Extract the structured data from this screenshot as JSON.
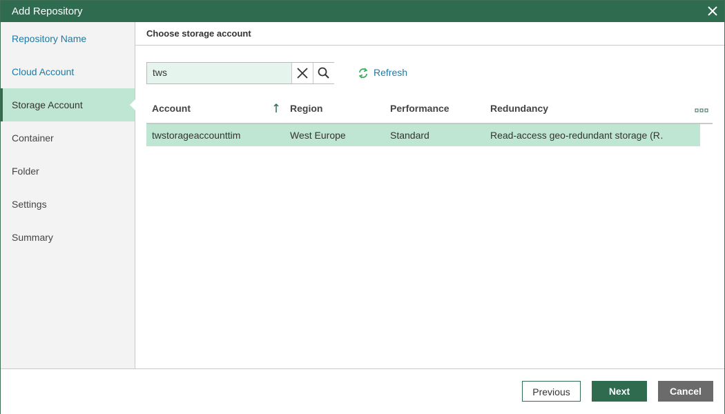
{
  "window": {
    "title": "Add Repository"
  },
  "sidebar": {
    "items": [
      {
        "label": "Repository Name",
        "state": "done"
      },
      {
        "label": "Cloud Account",
        "state": "done"
      },
      {
        "label": "Storage Account",
        "state": "active"
      },
      {
        "label": "Container",
        "state": "pending"
      },
      {
        "label": "Folder",
        "state": "pending"
      },
      {
        "label": "Settings",
        "state": "pending"
      },
      {
        "label": "Summary",
        "state": "pending"
      }
    ]
  },
  "main": {
    "section_title": "Choose storage account",
    "search": {
      "value": "tws",
      "clear_icon": "close-icon",
      "search_icon": "search-icon"
    },
    "refresh_label": "Refresh",
    "table": {
      "columns": [
        "Account",
        "Region",
        "Performance",
        "Redundancy"
      ],
      "sorted_column": "Account",
      "sort_direction": "ascending",
      "rows": [
        {
          "account": "twstorageaccounttim",
          "region": "West Europe",
          "performance": "Standard",
          "redundancy": "Read-access geo-redundant storage (R…",
          "selected": true
        }
      ]
    }
  },
  "footer": {
    "previous_label": "Previous",
    "next_label": "Next",
    "cancel_label": "Cancel"
  },
  "colors": {
    "accent": "#2e6b4f",
    "selection": "#bfe6d2",
    "link": "#1d7aa3",
    "cancel": "#6b6b6b"
  }
}
